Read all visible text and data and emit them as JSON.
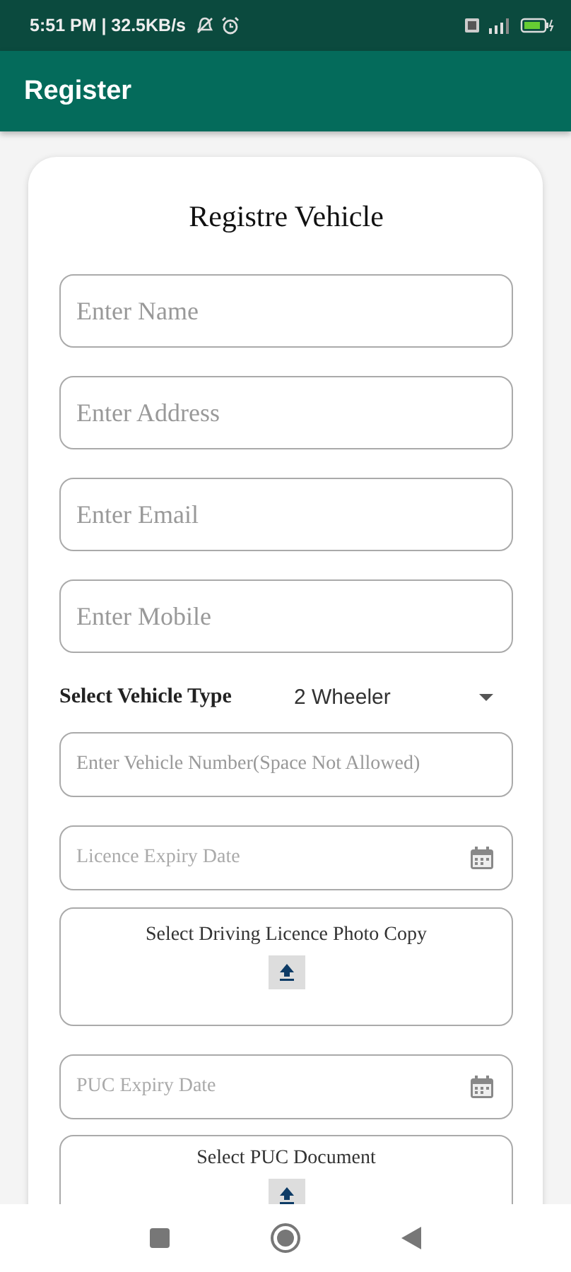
{
  "status_bar": {
    "time": "5:51 PM | 32.5KB/s"
  },
  "app_bar": {
    "title": "Register"
  },
  "form": {
    "title": "Registre Vehicle",
    "fields": [
      {
        "kind": "text",
        "placeholder": "Enter Name"
      },
      {
        "kind": "text",
        "placeholder": "Enter Address"
      },
      {
        "kind": "text",
        "placeholder": "Enter Email"
      },
      {
        "kind": "text",
        "placeholder": "Enter Mobile"
      },
      {
        "kind": "select",
        "label": "Select Vehicle Type",
        "value": "2 Wheeler"
      },
      {
        "kind": "text",
        "placeholder": "Enter Vehicle Number(Space Not Allowed)"
      },
      {
        "kind": "date",
        "placeholder": "Licence Expiry Date"
      },
      {
        "kind": "upload",
        "label": "Select Driving Licence Photo Copy"
      },
      {
        "kind": "date",
        "placeholder": "PUC Expiry Date"
      },
      {
        "kind": "upload",
        "label": "Select PUC Document"
      }
    ]
  }
}
